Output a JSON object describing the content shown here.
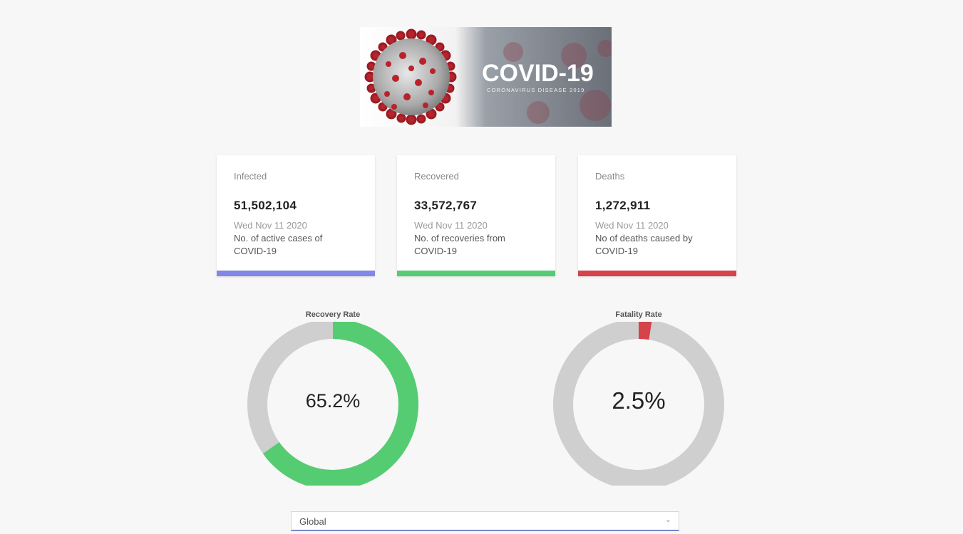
{
  "banner": {
    "title": "COVID-19",
    "subtitle": "CORONAVIRUS DISEASE 2019"
  },
  "cards": [
    {
      "title": "Infected",
      "value": "51,502,104",
      "date": "Wed Nov 11 2020",
      "desc": "No. of active cases of COVID-19",
      "color": "#8187e6"
    },
    {
      "title": "Recovered",
      "value": "33,572,767",
      "date": "Wed Nov 11 2020",
      "desc": "No. of recoveries from COVID-19",
      "color": "#55cc72"
    },
    {
      "title": "Deaths",
      "value": "1,272,911",
      "date": "Wed Nov 11 2020",
      "desc": "No of deaths caused by COVID-19",
      "color": "#d6434b"
    }
  ],
  "gauges": [
    {
      "title": "Recovery Rate",
      "label": "65.2%",
      "fraction": 0.652,
      "color": "#55cc72"
    },
    {
      "title": "Fatality Rate",
      "label": "2.5%",
      "fraction": 0.025,
      "color": "#d6434b"
    }
  ],
  "track_color": "#cfcfcf",
  "country_select": {
    "value": "Global"
  }
}
